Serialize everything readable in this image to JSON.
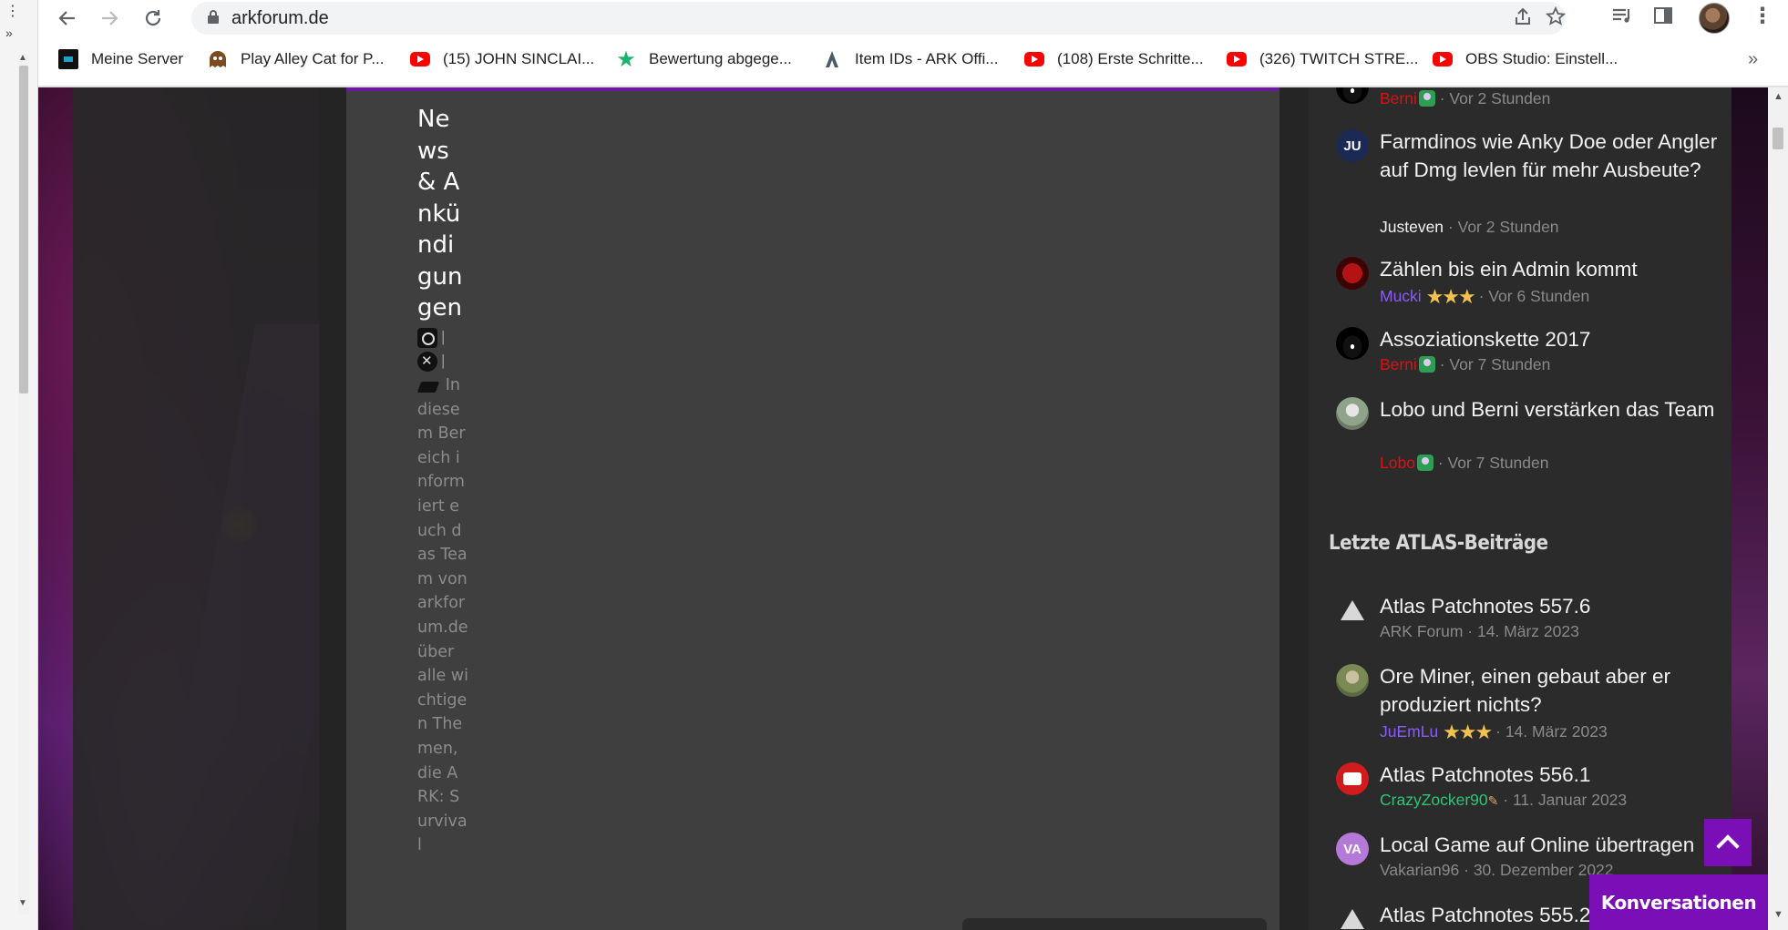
{
  "browser": {
    "url": "arkforum.de",
    "bookmarks": [
      {
        "label": "Meine Server",
        "icon": "monitor-icon"
      },
      {
        "label": "Play Alley Cat for P...",
        "icon": "pacman-icon"
      },
      {
        "label": "(15) JOHN SINCLAI...",
        "icon": "youtube-icon"
      },
      {
        "label": "Bewertung abgege...",
        "icon": "star-icon"
      },
      {
        "label": "Item IDs - ARK Offi...",
        "icon": "ark-icon"
      },
      {
        "label": "(108) Erste Schritte...",
        "icon": "youtube-icon"
      },
      {
        "label": "(326) TWITCH STRE...",
        "icon": "youtube-icon"
      },
      {
        "label": "OBS Studio: Einstell...",
        "icon": "youtube-icon"
      }
    ],
    "bookmarks_more": "»"
  },
  "os": {
    "menu_dots": "⋮",
    "chevron": "»"
  },
  "board": {
    "title": "News & Ankündigungen",
    "pipe": "|",
    "description": "In diesem Bereich informiert euch das Team von arkforum.de über alle wichtigen Themen, die ARK: Survival"
  },
  "sidebar": {
    "recent_threads": [
      {
        "title": "",
        "user": "Berni",
        "time": "· Vor 2 Stunden"
      },
      {
        "title": "Farmdinos wie Anky Doe oder Angler auf Dmg levlen für mehr Ausbeute?",
        "user": "Justeven",
        "time": "· Vor 2 Stunden",
        "avatar_text": "JU"
      },
      {
        "title": "Zählen bis ein Admin kommt",
        "user": "Mucki",
        "time": "· Vor 6 Stunden"
      },
      {
        "title": "Assoziationskette 2017",
        "user": "Berni",
        "time": "· Vor 7 Stunden"
      },
      {
        "title": "Lobo und Berni verstärken das Team",
        "user": "Lobo",
        "time": "· Vor 7 Stunden"
      }
    ],
    "atlas_title": "Letzte ATLAS-Beiträge",
    "atlas_posts": [
      {
        "title": "Atlas Patchnotes 557.6",
        "user": "ARK Forum",
        "time": "· 14. März 2023"
      },
      {
        "title": "Ore Miner, einen gebaut aber er produziert nichts?",
        "user": "JuEmLu",
        "time": "· 14. März 2023"
      },
      {
        "title": "Atlas Patchnotes 556.1",
        "user": "CrazyZocker90",
        "time": "· 11. Januar 2023"
      },
      {
        "title": "Local Game auf Online übertragen",
        "user": "Vakarian96",
        "time": "· 30. Dezember 2022",
        "avatar_text": "VA"
      },
      {
        "title": "Atlas Patchnotes 555.2",
        "user": "",
        "time": ""
      }
    ]
  },
  "floating": {
    "conversations": "Konversationen"
  },
  "colors": {
    "accent": "#7a0fb7",
    "user_red": "#e01010",
    "user_purple": "#8a5cf6",
    "user_green": "#2ec47a"
  }
}
